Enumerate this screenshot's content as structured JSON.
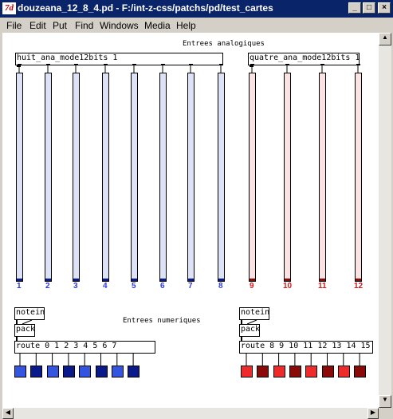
{
  "window": {
    "app_icon": "7d",
    "title": "douzeana_12_8_4.pd  - F:/int-z-css/patchs/pd/test_cartes",
    "buttons": {
      "minimize": "_",
      "maximize": "□",
      "close": "×"
    }
  },
  "menu": [
    "File",
    "Edit",
    "Put",
    "Find",
    "Windows",
    "Media",
    "Help"
  ],
  "patch": {
    "comment_analog": "Entrees analogiques",
    "comment_numeric": "Entrees numeriques",
    "obj_huit": "huit_ana_mode12bits 1",
    "obj_quatre": "quatre_ana_mode12bits 1",
    "left": {
      "notein": "notein",
      "pack": "pack",
      "route": "route 0 1 2 3 4 5 6 7"
    },
    "right": {
      "notein": "notein",
      "pack": "pack",
      "route": "route 8 9 10 11 12 13 14 15"
    },
    "sliders": [
      {
        "label": "1",
        "group": "blue"
      },
      {
        "label": "2",
        "group": "blue"
      },
      {
        "label": "3",
        "group": "blue"
      },
      {
        "label": "4",
        "group": "blue"
      },
      {
        "label": "5",
        "group": "blue"
      },
      {
        "label": "6",
        "group": "blue"
      },
      {
        "label": "7",
        "group": "blue"
      },
      {
        "label": "8",
        "group": "blue"
      },
      {
        "label": "9",
        "group": "red"
      },
      {
        "label": "10",
        "group": "red"
      },
      {
        "label": "11",
        "group": "red"
      },
      {
        "label": "12",
        "group": "red"
      }
    ],
    "toggles_left": [
      "#3355e0",
      "#0a1a8a",
      "#3355e0",
      "#0a1a8a",
      "#3355e0",
      "#0a1a8a",
      "#3355e0",
      "#0a1a8a"
    ],
    "toggles_right": [
      "#ee2a2a",
      "#8a0a0a",
      "#ee2a2a",
      "#8a0a0a",
      "#ee2a2a",
      "#8a0a0a",
      "#ee2a2a",
      "#8a0a0a"
    ]
  },
  "colors": {
    "blue_fill": "#dde2f7",
    "blue_knob": "#0a1a8a",
    "blue_label": "#2b3be0",
    "red_fill": "#fbe3e3",
    "red_knob": "#8a0a0a",
    "red_label": "#d41a1a"
  }
}
